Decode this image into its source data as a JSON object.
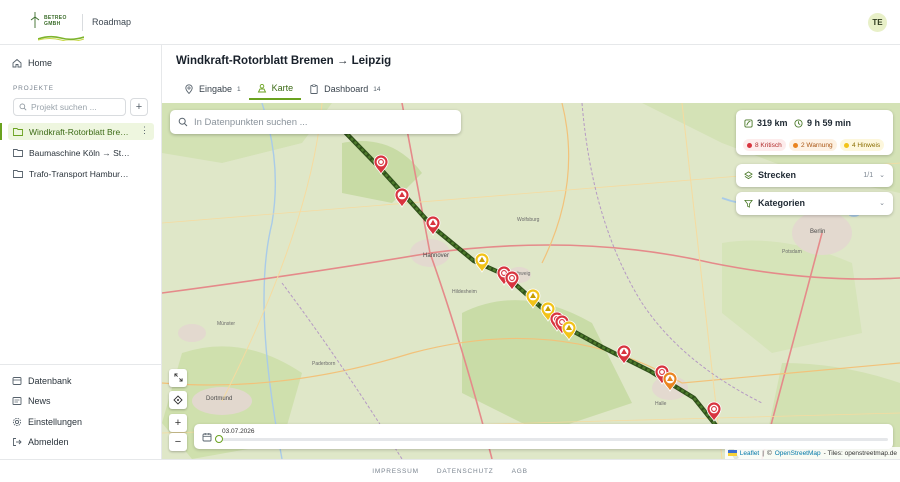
{
  "header": {
    "logo_text": "BETREO GMBH",
    "title": "Roadmap",
    "avatar_initials": "TE"
  },
  "sidebar": {
    "home": "Home",
    "section_label": "PROJEKTE",
    "search_placeholder": "Projekt suchen ...",
    "add_label": "+",
    "projects": [
      {
        "label": "Windkraft-Rotorblatt Bremen → Leipzig",
        "active": true
      },
      {
        "label": "Baumaschine Köln → Stuttgart",
        "active": false
      },
      {
        "label": "Trafo-Transport Hamburg → München",
        "active": false
      }
    ],
    "bottom_links": [
      "Datenbank",
      "News",
      "Einstellungen",
      "Abmelden"
    ]
  },
  "page": {
    "title": "Windkraft-Rotorblatt Bremen → Leipzig",
    "tabs": [
      {
        "label": "Eingabe",
        "badge": "1",
        "icon": "pin-icon",
        "active": false
      },
      {
        "label": "Karte",
        "badge": "",
        "icon": "user-map-icon",
        "active": true
      },
      {
        "label": "Dashboard",
        "badge": "14",
        "icon": "clipboard-icon",
        "active": false
      }
    ]
  },
  "map": {
    "search_placeholder": "In Datenpunkten suchen ...",
    "distance": "319 km",
    "duration": "9 h 59 min",
    "chips": {
      "critical": "8 Kritisch",
      "warning": "2 Warnung",
      "hint": "4 Hinweis"
    },
    "routes_label": "Strecken",
    "routes_count": "1/1",
    "categories_label": "Kategorien",
    "timeline_date": "03.07.2026",
    "attribution": {
      "leaflet": "Leaflet",
      "sep": "|",
      "osm_prefix": "©",
      "osm": "OpenStreetMap",
      "tiles": "- Tiles: openstreetmap.de"
    },
    "cities": [
      {
        "name": "Hannover"
      },
      {
        "name": "Berlin"
      },
      {
        "name": "Wolfsburg"
      },
      {
        "name": "Hildesheim"
      },
      {
        "name": "Dortmund"
      },
      {
        "name": "Halle"
      },
      {
        "name": "Potsdam"
      },
      {
        "name": "Münster"
      },
      {
        "name": "Paderborn"
      },
      {
        "name": "Braunschweig"
      }
    ],
    "colors": {
      "route": "#4c7a2b",
      "critical": "#d8343f",
      "warning": "#e98420",
      "hint": "#f2c318"
    }
  },
  "footer": {
    "links": [
      "IMPRESSUM",
      "DATENSCHUTZ",
      "AGB"
    ]
  }
}
